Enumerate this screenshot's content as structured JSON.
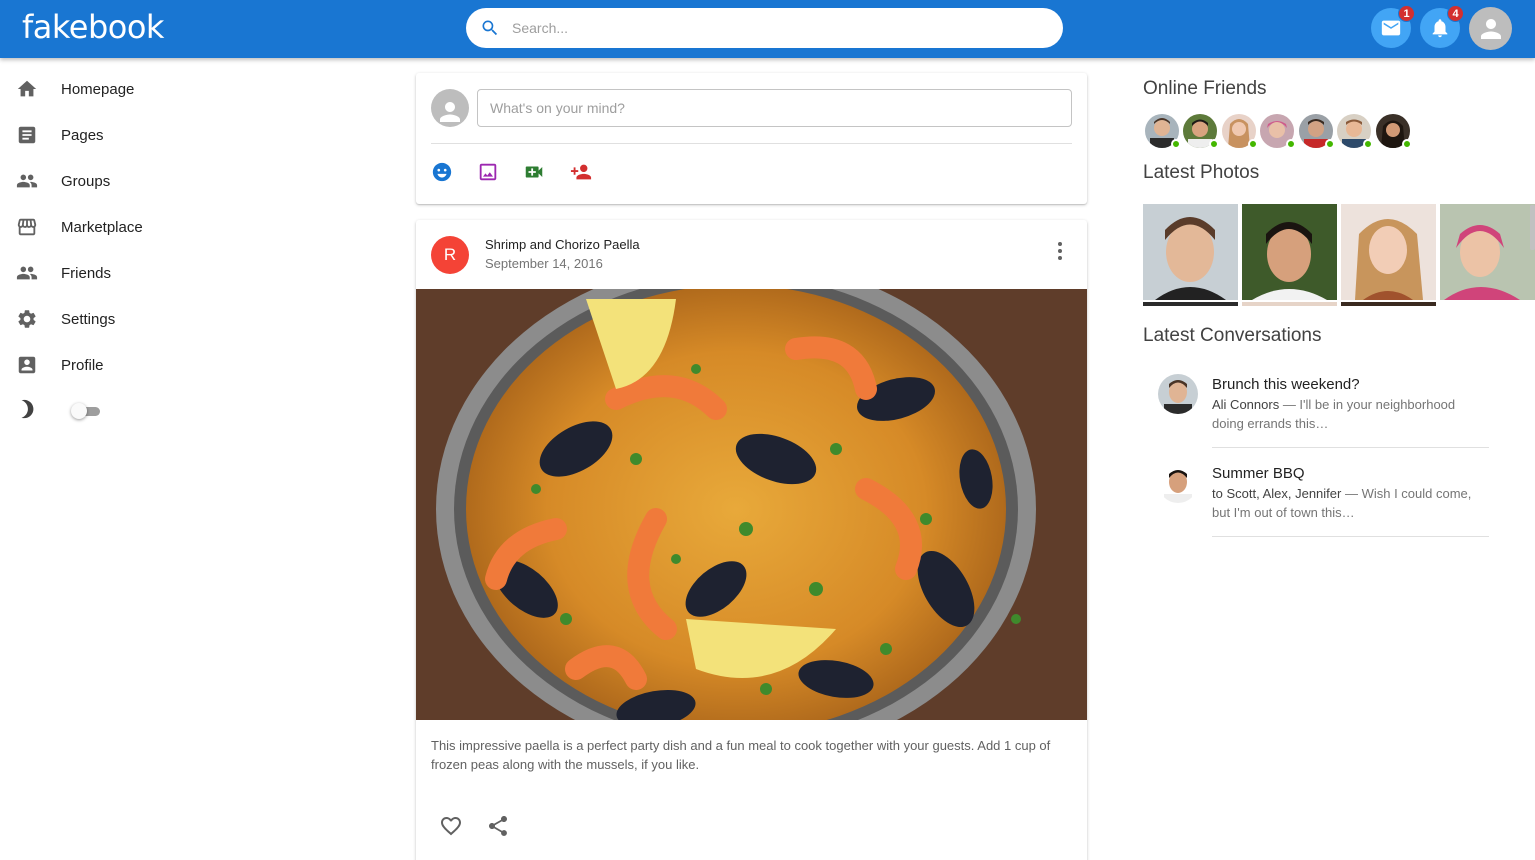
{
  "app": {
    "logo": "fakebook"
  },
  "header": {
    "search_placeholder": "Search...",
    "messages_badge": "1",
    "notifications_badge": "4"
  },
  "sidebar": {
    "items": [
      {
        "label": "Homepage",
        "icon": "home-icon"
      },
      {
        "label": "Pages",
        "icon": "article-icon"
      },
      {
        "label": "Groups",
        "icon": "groups-icon"
      },
      {
        "label": "Marketplace",
        "icon": "storefront-icon"
      },
      {
        "label": "Friends",
        "icon": "friends-icon"
      },
      {
        "label": "Settings",
        "icon": "gear-icon"
      },
      {
        "label": "Profile",
        "icon": "profile-icon"
      }
    ],
    "dark_mode_on": false
  },
  "composer": {
    "placeholder": "What's on your mind?",
    "actions": [
      {
        "icon": "emoji-icon",
        "color": "#1976d2"
      },
      {
        "icon": "image-icon",
        "color": "#9c27b0"
      },
      {
        "icon": "video-icon",
        "color": "#2e7d32"
      },
      {
        "icon": "tag-friend-icon",
        "color": "#d32f2f"
      }
    ]
  },
  "post": {
    "avatar_letter": "R",
    "title": "Shrimp and Chorizo Paella",
    "date": "September 14, 2016",
    "body": "This impressive paella is a perfect party dish and a fun meal to cook together with your guests. Add 1 cup of frozen peas along with the mussels, if you like."
  },
  "right": {
    "online_heading": "Online Friends",
    "online_count": 7,
    "photos_heading": "Latest Photos",
    "conversations_heading": "Latest Conversations",
    "conversations": [
      {
        "title": "Brunch this weekend?",
        "who": "Ali Connors",
        "preview": " — I'll be in your neighborhood doing errands this…"
      },
      {
        "title": "Summer BBQ",
        "who": "to Scott, Alex, Jennifer",
        "preview": " — Wish I could come, but I'm out of town this…"
      }
    ]
  },
  "colors": {
    "primary": "#1976d2",
    "badge": "#d32f2f",
    "online": "#44b700",
    "post_avatar": "#f44336"
  }
}
